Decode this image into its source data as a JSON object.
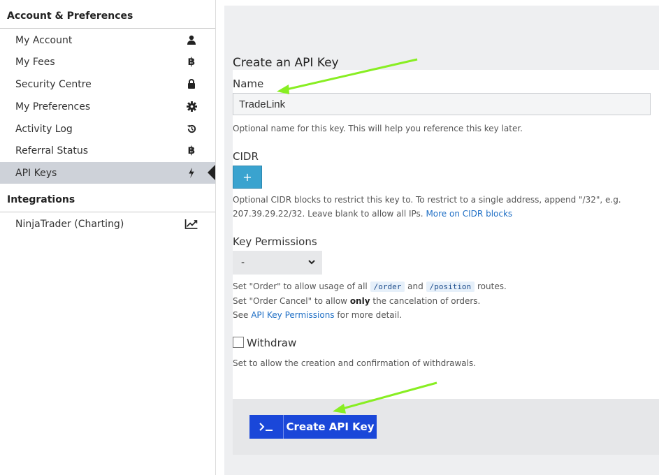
{
  "sidebar": {
    "section1": "Account & Preferences",
    "items": [
      {
        "label": "My Account",
        "icon": "user-icon"
      },
      {
        "label": "My Fees",
        "icon": "bitcoin-icon"
      },
      {
        "label": "Security Centre",
        "icon": "lock-icon"
      },
      {
        "label": "My Preferences",
        "icon": "gear-icon"
      },
      {
        "label": "Activity Log",
        "icon": "history-icon"
      },
      {
        "label": "Referral Status",
        "icon": "bitcoin-icon"
      },
      {
        "label": "API Keys",
        "icon": "lightning-icon",
        "active": true
      }
    ],
    "section2": "Integrations",
    "integrations": [
      {
        "label": "NinjaTrader (Charting)",
        "icon": "line-chart-icon"
      }
    ]
  },
  "form": {
    "title": "Create an API Key",
    "name_label": "Name",
    "name_value": "TradeLink",
    "name_help": "Optional name for this key. This will help you reference this key later.",
    "cidr_label": "CIDR",
    "cidr_button": "+",
    "cidr_help_1": "Optional CIDR blocks to restrict this key to. To restrict to a single address, append \"/32\", e.g.",
    "cidr_help_2": "207.39.29.22/32. Leave blank to allow all IPs.",
    "cidr_link": "More on CIDR blocks",
    "perm_label": "Key Permissions",
    "perm_selected": "-",
    "perm_help_1a": "Set \"Order\" to allow usage of all",
    "perm_code_1": "/order",
    "perm_help_1b": "and",
    "perm_code_2": "/position",
    "perm_help_1c": "routes.",
    "perm_help_2a": "Set \"Order Cancel\" to allow",
    "perm_help_2b": "only",
    "perm_help_2c": "the cancelation of orders.",
    "perm_help_3a": "See",
    "perm_link": "API Key Permissions",
    "perm_help_3b": "for more detail.",
    "withdraw_label": "Withdraw",
    "withdraw_checked": false,
    "withdraw_help": "Set to allow the creation and confirmation of withdrawals.",
    "submit_label": "Create API Key"
  },
  "colors": {
    "accent": "#1a47d9",
    "cidr_button": "#3aa3cf",
    "link": "#1f6fc5",
    "annotation_arrow": "#88ee22"
  }
}
